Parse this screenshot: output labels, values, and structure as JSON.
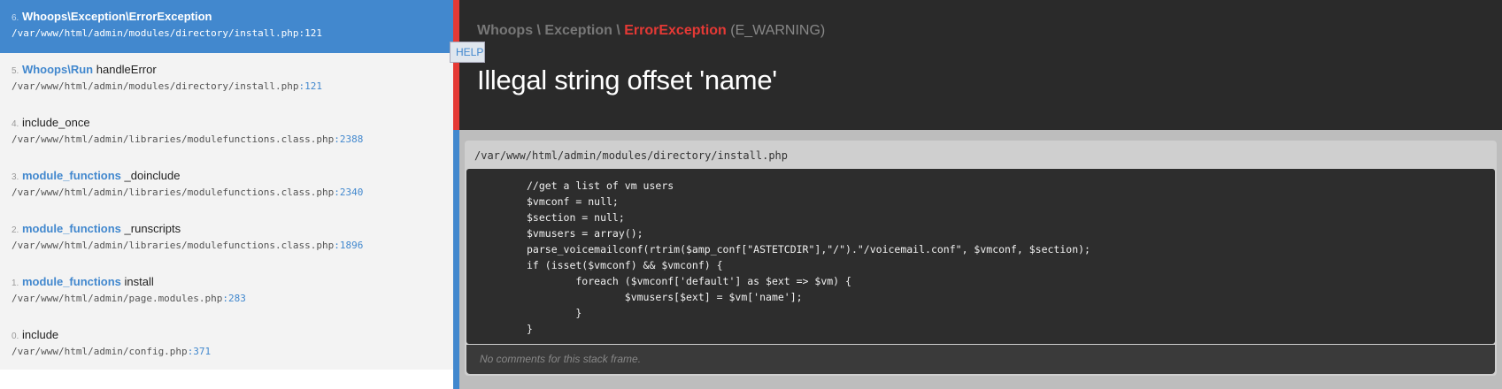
{
  "frames": [
    {
      "index": "6.",
      "class": "Whoops\\Exception\\ErrorException",
      "function": "",
      "file": "/var/www/html/admin/modules/directory/install.php",
      "line": ":121"
    },
    {
      "index": "5.",
      "class": "Whoops\\Run",
      "function": "handleError",
      "file": "/var/www/html/admin/modules/directory/install.php",
      "line": ":121"
    },
    {
      "index": "4.",
      "class": "",
      "function": "include_once",
      "file": "/var/www/html/admin/libraries/modulefunctions.class.php",
      "line": ":2388"
    },
    {
      "index": "3.",
      "class": "module_functions",
      "function": "_doinclude",
      "file": "/var/www/html/admin/libraries/modulefunctions.class.php",
      "line": ":2340"
    },
    {
      "index": "2.",
      "class": "module_functions",
      "function": "_runscripts",
      "file": "/var/www/html/admin/libraries/modulefunctions.class.php",
      "line": ":1896"
    },
    {
      "index": "1.",
      "class": "module_functions",
      "function": "install",
      "file": "/var/www/html/admin/page.modules.php",
      "line": ":283"
    },
    {
      "index": "0.",
      "class": "",
      "function": "include",
      "file": "/var/www/html/admin/config.php",
      "line": ":371"
    }
  ],
  "exception": {
    "class_prefix": "Whoops \\ Exception \\",
    "class_name": "ErrorException",
    "severity": "(E_WARNING)",
    "message": "Illegal string offset 'name'"
  },
  "help_button": "HELP",
  "code_panel": {
    "file_path": "/var/www/html/admin/modules/directory/install.php",
    "lines": [
      "//get a list of vm users",
      "$vmconf = null;",
      "$section = null;",
      "$vmusers = array();",
      "parse_voicemailconf(rtrim($amp_conf[\"ASTETCDIR\"],\"/\").\"/voicemail.conf\", $vmconf, $section);",
      "if (isset($vmconf) && $vmconf) {",
      "        foreach ($vmconf['default'] as $ext => $vm) {",
      "                $vmusers[$ext] = $vm['name'];",
      "        }",
      "}"
    ],
    "comments_text": "No comments for this stack frame."
  },
  "colors": {
    "accent": "#4288ce",
    "error": "#e53935"
  }
}
